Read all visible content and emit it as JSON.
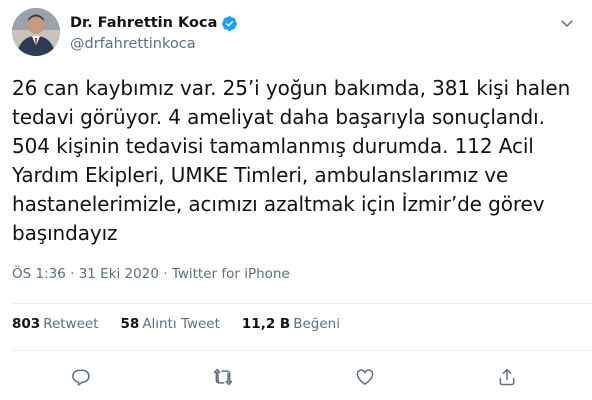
{
  "author": {
    "display_name": "Dr. Fahrettin Koca",
    "handle": "@drfahrettinkoca",
    "verified": true,
    "avatar_icon": "profile-photo"
  },
  "tweet": {
    "text": "26 can kaybımız var. 25’i yoğun bakımda, 381 kişi halen\ntedavi görüyor. 4 ameliyat daha başarıyla sonuçlandı.\n504 kişinin tedavisi tamamlanmış durumda. 112 Acil\nYardım Ekipleri, UMKE Timleri, ambulanslarımız ve\nhastanelerimizle, acımızı azaltmak için İzmir’de görev\nbaşındayız",
    "time": "ÖS 1:36",
    "separator": "·",
    "date": "31 Eki 2020",
    "source": "Twitter for iPhone"
  },
  "stats": {
    "retweets": {
      "count": "803",
      "label": "Retweet"
    },
    "quotes": {
      "count": "58",
      "label": "Alıntı Tweet"
    },
    "likes": {
      "count": "11,2 B",
      "label": "Beğeni"
    }
  },
  "icons": {
    "verified": "verified-badge-icon",
    "more": "chevron-down-icon",
    "reply": "reply-icon",
    "retweet": "retweet-icon",
    "like": "heart-icon",
    "share": "share-icon"
  },
  "colors": {
    "text": "#0f1419",
    "secondary": "#5b7083",
    "verified": "#1da1f2",
    "divider": "#ebeef0"
  }
}
